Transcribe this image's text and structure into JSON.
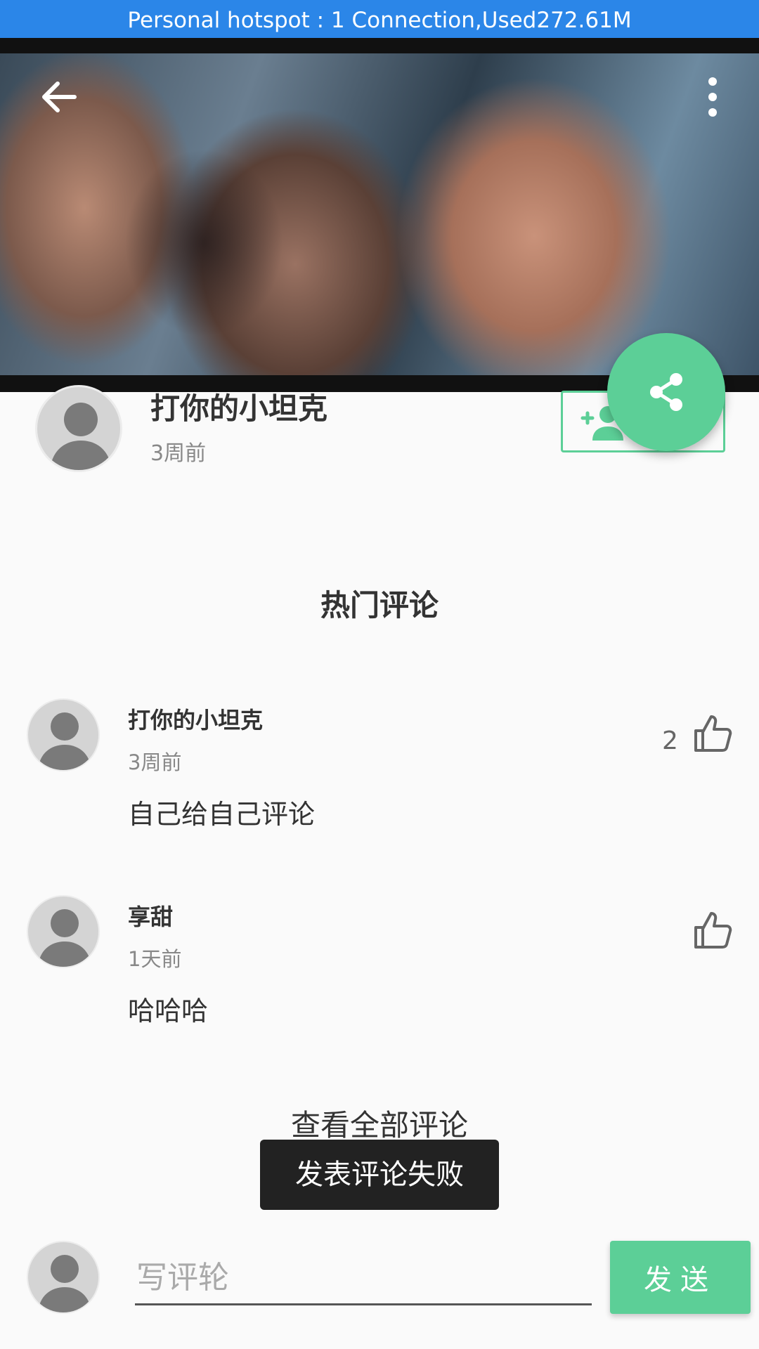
{
  "status_bar": {
    "text": "Personal hotspot : 1 Connection,Used272.61M"
  },
  "video": {
    "back_icon": "arrow-left-icon",
    "more_icon": "more-vert-icon"
  },
  "share_fab": {
    "icon": "share-icon"
  },
  "author": {
    "name": "打你的小坦克",
    "time": "3周前",
    "follow_icon": "person-add-icon"
  },
  "comments_section": {
    "title": "热门评论",
    "items": [
      {
        "name": "打你的小坦克",
        "time": "3周前",
        "text": "自己给自己评论",
        "likes": "2"
      },
      {
        "name": "享甜",
        "time": "1天前",
        "text": "哈哈哈",
        "likes": ""
      }
    ],
    "view_all": "查看全部评论"
  },
  "toast": {
    "text": "发表评论失败"
  },
  "composer": {
    "placeholder": "写评轮",
    "value": "",
    "send_label": "发送"
  },
  "colors": {
    "accent": "#5ccf97",
    "status_bar": "#2b86e8",
    "toast_bg": "#222222"
  }
}
